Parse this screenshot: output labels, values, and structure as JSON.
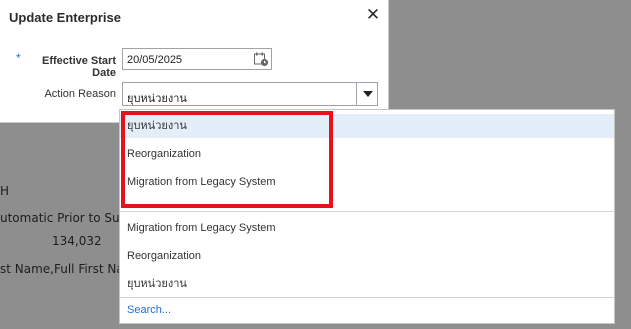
{
  "dialog": {
    "title": "Update Enterprise",
    "required_marker": "*",
    "start_date_label": "Effective Start Date",
    "start_date_value": "20/05/2025",
    "action_reason_label": "Action Reason",
    "action_reason_value": "ยุบหน่วยงาน"
  },
  "dropdown": {
    "recent_options": [
      "ยุบหน่วยงาน",
      "Reorganization",
      "Migration from Legacy System"
    ],
    "all_options": [
      "Migration from Legacy System",
      "Reorganization",
      "ยุบหน่วยงาน"
    ],
    "search_label": "Search..."
  },
  "background": {
    "line1": "H",
    "line2": "utomatic Prior to Submi",
    "line3": "134,032",
    "line4": "st Name,Full First Name"
  },
  "colors": {
    "highlight": "#e4eef8",
    "link": "#1d6fd6",
    "annotation": "#e3121b"
  }
}
